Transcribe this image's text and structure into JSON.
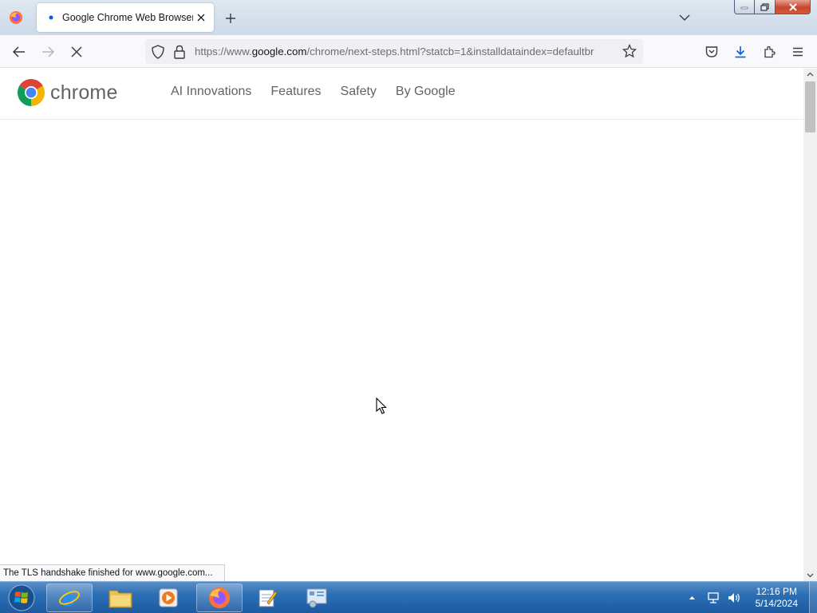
{
  "browser": {
    "tab": {
      "title": "Google Chrome Web Browser"
    },
    "url": {
      "prefix": "https://www.",
      "host": "google.com",
      "path": "/chrome/next-steps.html?statcb=1&installdataindex=defaultbr"
    },
    "status_text": "The TLS handshake finished for www.google.com..."
  },
  "page": {
    "logo_text": "chrome",
    "nav": [
      {
        "label": "AI Innovations"
      },
      {
        "label": "Features"
      },
      {
        "label": "Safety"
      },
      {
        "label": "By Google"
      }
    ]
  },
  "taskbar": {
    "time": "12:16 PM",
    "date": "5/14/2024",
    "apps": [
      "internet-explorer",
      "file-explorer",
      "media-player",
      "firefox",
      "notepad",
      "control-panel"
    ]
  },
  "colors": {
    "chrome_red": "#db4437",
    "chrome_yellow": "#f4b400",
    "chrome_green": "#0f9d58",
    "chrome_blue": "#4285f4",
    "firefox_accent": "#0061e0"
  }
}
